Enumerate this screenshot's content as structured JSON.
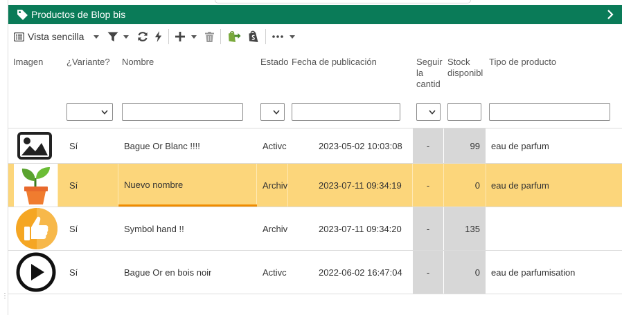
{
  "panel": {
    "title": "Productos de Blop bis",
    "title_icon": "tag-icon",
    "expand_icon": "chevron-right-icon",
    "accent_color": "#0a7b58"
  },
  "toolbar": {
    "view_label": "Vista sencilla",
    "icons": [
      "list-view-icon",
      "filter-icon",
      "refresh-icon",
      "bolt-icon",
      "plus-icon",
      "trash-icon",
      "shopify-export-icon",
      "shopify-icon",
      "more-icon"
    ]
  },
  "columns": [
    {
      "key": "image",
      "label": "Imagen"
    },
    {
      "key": "variant",
      "label": "¿Variante?"
    },
    {
      "key": "name",
      "label": "Nombre"
    },
    {
      "key": "status",
      "label": "Estado"
    },
    {
      "key": "published",
      "label": "Fecha de publicación"
    },
    {
      "key": "track",
      "label": "Seguir la cantidad"
    },
    {
      "key": "stock",
      "label": "Stock disponible"
    },
    {
      "key": "type",
      "label": "Tipo de producto"
    }
  ],
  "header_display": {
    "track_lines": [
      "Seguir",
      "la",
      "cantid"
    ],
    "stock_lines": [
      "Stock",
      "disponibl"
    ]
  },
  "rows": [
    {
      "image": "image-placeholder-icon",
      "variant": "Sí",
      "name": "Bague Or Blanc !!!!",
      "status": "Activo",
      "status_display": "Activc",
      "published": "2023-05-02 10:03:08",
      "track": "-",
      "stock": "99",
      "type": "eau de parfum",
      "selected": false
    },
    {
      "image": "plant-pot-icon",
      "variant": "Sí",
      "name": "Nuevo nombre",
      "status": "Archivado",
      "status_display": "Archiv",
      "published": "2023-07-11 09:34:19",
      "track": "-",
      "stock": "0",
      "type": "eau de parfum",
      "selected": true
    },
    {
      "image": "thumbs-up-icon",
      "variant": "Sí",
      "name": "Symbol hand !!",
      "status": "Archivado",
      "status_display": "Archiv",
      "published": "2023-07-11 09:34:20",
      "track": "-",
      "stock": "135",
      "type": "",
      "selected": false
    },
    {
      "image": "play-circle-icon",
      "variant": "Sí",
      "name": "Bague Or en bois noir",
      "status": "Activo",
      "status_display": "Activc",
      "published": "2022-06-02 16:47:04",
      "track": "-",
      "stock": "0",
      "type": "eau de parfumisation",
      "selected": false
    }
  ],
  "colors": {
    "selected_row": "#fcd67b",
    "edit_underline": "#f08c00",
    "shaded_cell": "#d7d7d7"
  }
}
